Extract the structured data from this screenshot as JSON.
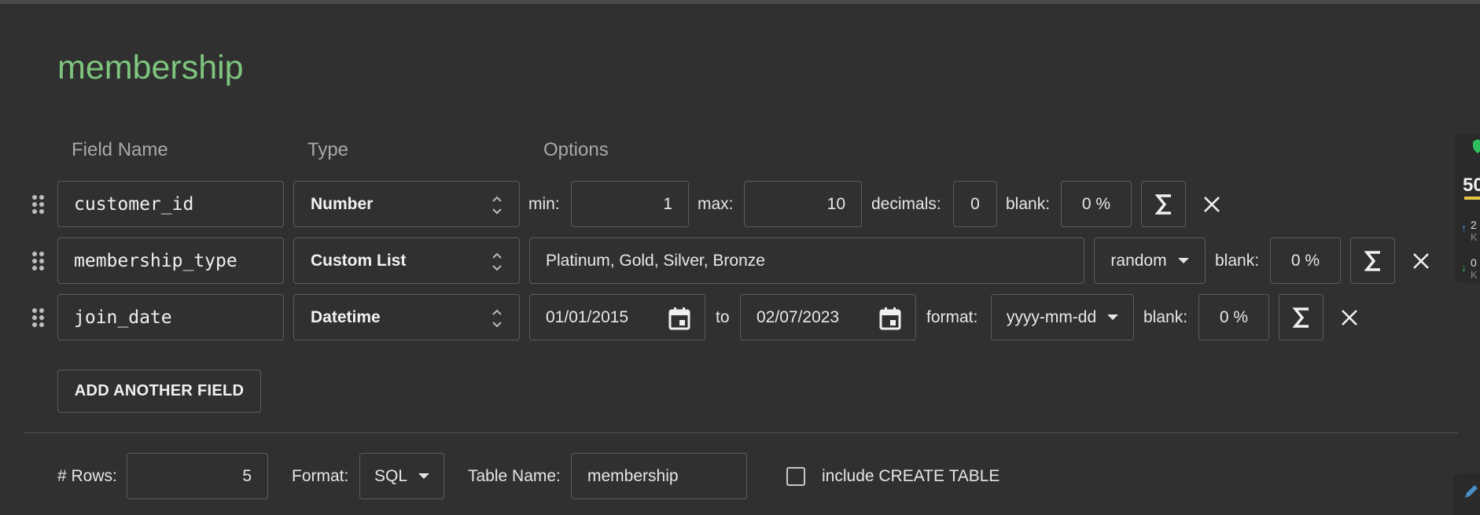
{
  "table_title": "membership",
  "headers": {
    "field_name": "Field Name",
    "type": "Type",
    "options": "Options"
  },
  "rows": [
    {
      "field": "customer_id",
      "type": "Number",
      "min_label": "min:",
      "min": "1",
      "max_label": "max:",
      "max": "10",
      "decimals_label": "decimals:",
      "decimals": "0",
      "blank_label": "blank:",
      "blank": "0 %"
    },
    {
      "field": "membership_type",
      "type": "Custom List",
      "values": "Platinum, Gold, Silver, Bronze",
      "order": "random",
      "blank_label": "blank:",
      "blank": "0 %"
    },
    {
      "field": "join_date",
      "type": "Datetime",
      "from": "01/01/2015",
      "to_label": "to",
      "to": "02/07/2023",
      "format_label": "format:",
      "format": "yyyy-mm-dd",
      "blank_label": "blank:",
      "blank": "0 %"
    }
  ],
  "add_field_label": "ADD ANOTHER FIELD",
  "footer": {
    "rows_label": "# Rows:",
    "rows": "5",
    "format_label": "Format:",
    "format": "SQL",
    "table_name_label": "Table Name:",
    "table_name": "membership",
    "include_create_label": "include CREATE TABLE",
    "include_create_checked": false
  },
  "extension_partial": {
    "top": "50",
    "line1": "2",
    "line2": "K",
    "line3": "0",
    "line4": "K"
  },
  "colors": {
    "title": "#7ec57e",
    "background": "#303030"
  },
  "icons": [
    "drag-handle-icon",
    "updown-arrows-icon",
    "calendar-icon",
    "sigma-icon",
    "close-icon",
    "caret-down-icon",
    "shield-icon"
  ]
}
